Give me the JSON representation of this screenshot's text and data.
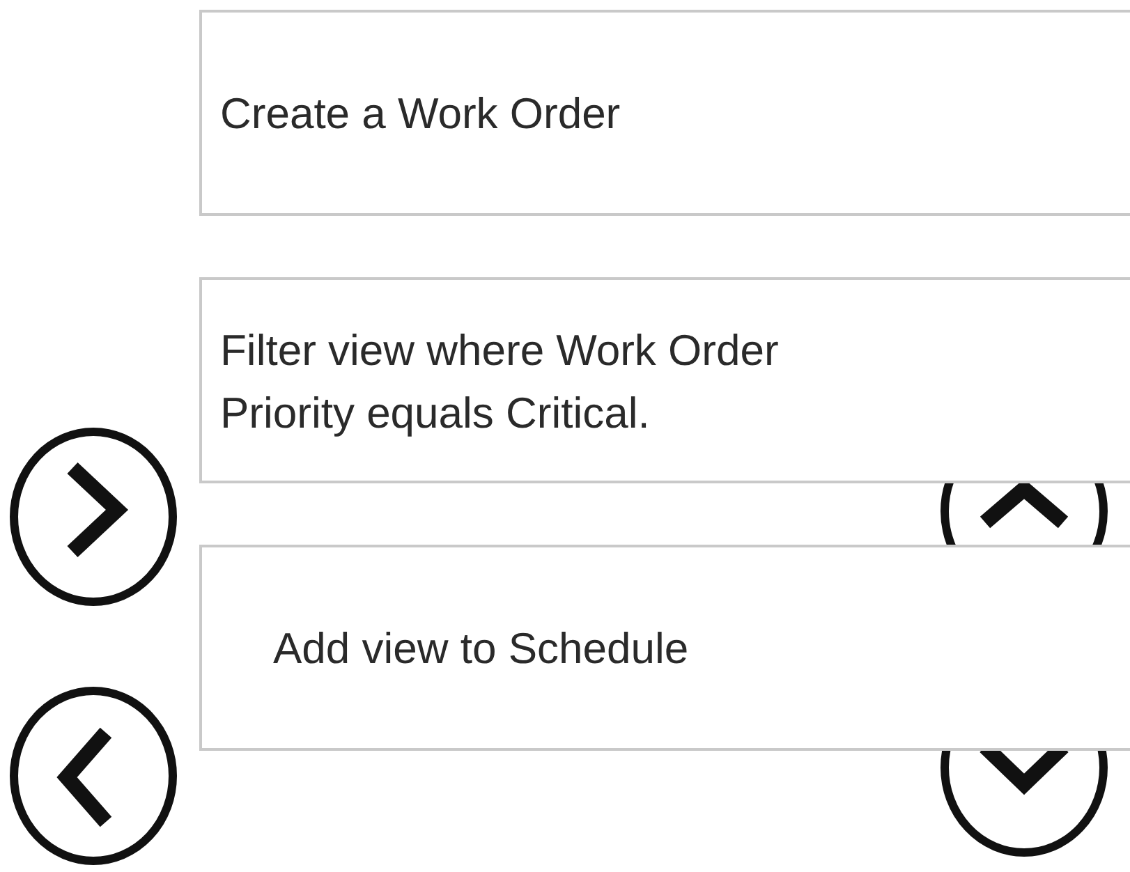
{
  "items": [
    {
      "text": "Create a Work Order",
      "indented": false
    },
    {
      "text": "Filter view where Work Order Priority equals Critical.",
      "indented": false
    },
    {
      "text": "Add view to Schedule",
      "indented": true
    }
  ]
}
